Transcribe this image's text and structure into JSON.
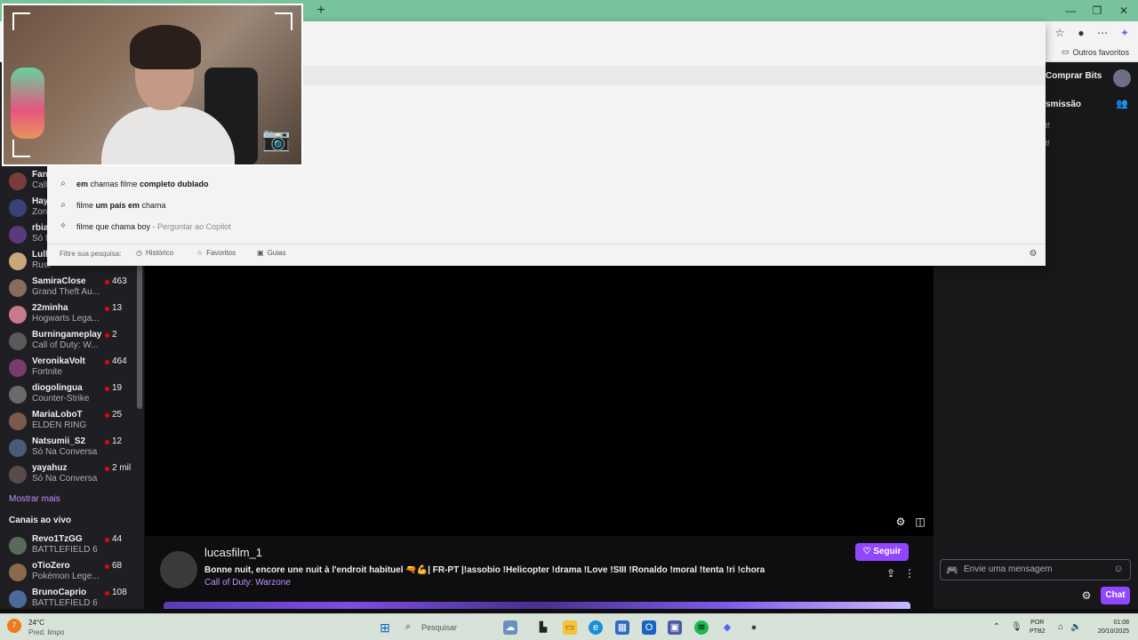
{
  "browser": {
    "new_tab_glyph": "+",
    "favorites_folder": "Outros favoritos",
    "icons": [
      "minimize-icon",
      "maximize-icon",
      "close-icon",
      "favorites-star-icon",
      "profile-icon",
      "more-icon",
      "copilot-icon"
    ]
  },
  "sidebar": {
    "channels": [
      {
        "name": "Fan",
        "game": "Call",
        "viewers": "",
        "color": "#7a3b3b"
      },
      {
        "name": "Hay",
        "game": "Zon",
        "viewers": "",
        "color": "#3b3f7a"
      },
      {
        "name": "rbia",
        "game": "Só N",
        "viewers": "",
        "color": "#5a3b7a"
      },
      {
        "name": "Lull",
        "game": "Rust",
        "viewers": "",
        "color": "#c9a77a"
      },
      {
        "name": "SamiraClose",
        "game": "Grand Theft Au...",
        "viewers": "463",
        "color": "#8a6a5a"
      },
      {
        "name": "22minha",
        "game": "Hogwarts Lega...",
        "viewers": "13",
        "color": "#c77a8a"
      },
      {
        "name": "Burningameplay",
        "game": "Call of Duty: W...",
        "viewers": "2",
        "color": "#5a5a5a"
      },
      {
        "name": "VeronikaVolt",
        "game": "Fortnite",
        "viewers": "464",
        "color": "#7a3b6a"
      },
      {
        "name": "diogolingua",
        "game": "Counter-Strike",
        "viewers": "19",
        "color": "#6a6a6a"
      },
      {
        "name": "MariaLoboT",
        "game": "ELDEN RING",
        "viewers": "25",
        "color": "#7a5a4a"
      },
      {
        "name": "Natsumii_S2",
        "game": "Só Na Conversa",
        "viewers": "12",
        "color": "#4a5a7a"
      },
      {
        "name": "yayahuz",
        "game": "Só Na Conversa",
        "viewers": "2 mil",
        "color": "#5a4a4a"
      }
    ],
    "show_more": "Mostrar mais",
    "live_section_title": "Canais ao vivo",
    "live_channels": [
      {
        "name": "Revo1TzGG",
        "game": "BATTLEFIELD 6",
        "viewers": "44",
        "color": "#5a6a5a"
      },
      {
        "name": "oTioZero",
        "game": "Pokémon Lege...",
        "viewers": "68",
        "color": "#8a6a4a"
      },
      {
        "name": "BrunoCaprio",
        "game": "BATTLEFIELD 6",
        "viewers": "108",
        "color": "#4a6a9a"
      }
    ]
  },
  "search_dropdown": {
    "suggestions": [
      {
        "parts": [
          {
            "t": "em ",
            "b": true
          },
          {
            "t": "chama",
            "b": false
          },
          {
            "t": "s filme ",
            "b": false
          },
          {
            "t": "completo dublado",
            "b": true
          }
        ],
        "suffix": ""
      },
      {
        "parts": [
          {
            "t": "filme ",
            "b": false
          },
          {
            "t": "um país em",
            "b": true
          },
          {
            "t": " chama",
            "b": false
          }
        ],
        "suffix": ""
      },
      {
        "parts": [
          {
            "t": "filme que chama boy",
            "b": false
          }
        ],
        "suffix": " - Perguntar ao Copilot"
      }
    ],
    "filter_label": "Filtre sua pesquisa:",
    "filters": [
      "Histórico",
      "Favoritos",
      "Guias"
    ]
  },
  "stream": {
    "streamer": "lucasfilm_1",
    "title": "Bonne nuit, encore une nuit à l'endroit habituel 🔫💪| FR-PT |!assobio !Helicopter !drama !Love !SIII !Ronaldo !moral !tenta !ri !chora",
    "category": "Call of Duty: Warzone",
    "follow_label": "Seguir"
  },
  "chat": {
    "bits_label": "Comprar Bits",
    "header_fragment": "smissão",
    "messages": [
      "t!",
      "t!"
    ],
    "input_placeholder": "Envie uma mensagem",
    "chat_button": "Chat"
  },
  "taskbar": {
    "weather_badge": "7",
    "temp": "24°C",
    "condition": "Pred. limpo",
    "search_placeholder": "Pesquisar",
    "lang_line1": "POR",
    "lang_line2": "PTB2",
    "time": "01:08",
    "date": "20/10/2025"
  },
  "colors": {
    "accent": "#9147ff",
    "link": "#bf94ff",
    "live_dot": "#eb0400",
    "tabbar": "#78c29c"
  }
}
